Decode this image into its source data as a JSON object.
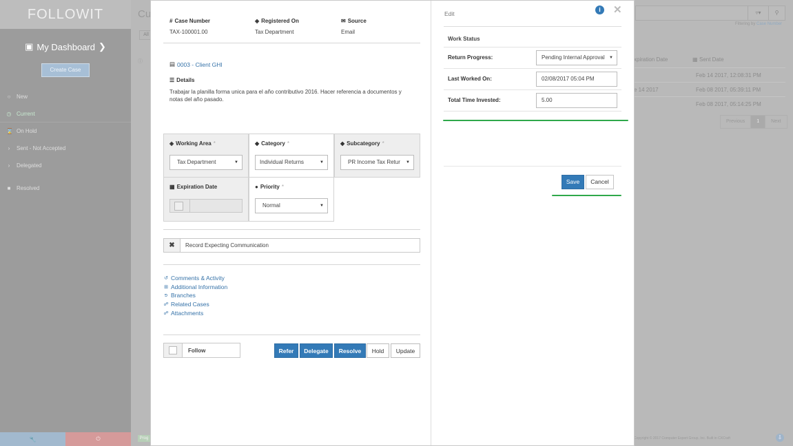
{
  "app": {
    "logo": "FOLLOWIT"
  },
  "sidebar": {
    "dashboard_label": "My Dashboard",
    "create_case_label": "Create Case",
    "items": [
      {
        "label": "New",
        "icon": "circle-icon"
      },
      {
        "label": "Current",
        "icon": "clock-icon"
      },
      {
        "label": "On Hold",
        "icon": "hourglass-icon"
      },
      {
        "label": "Sent - Not Accepted",
        "icon": "chevron-right-icon"
      },
      {
        "label": "Delegated",
        "icon": "chevron-right-icon"
      },
      {
        "label": "Resolved",
        "icon": "square-icon"
      }
    ]
  },
  "background": {
    "title": "Cu",
    "all_label": "All",
    "filtering_prefix": "Filtering by",
    "filtering_link": "Case Number",
    "col_expiration": "xpiration Date",
    "col_sent": "Sent Date",
    "rows": [
      {
        "expiration": "",
        "sent": "Feb 14 2017, 12:08:31 PM"
      },
      {
        "expiration": "e 14 2017",
        "sent": "Feb 08 2017, 05:39:11 PM"
      },
      {
        "expiration": "",
        "sent": "Feb 08 2017, 05:14:25 PM"
      }
    ],
    "pager": {
      "prev": "Previous",
      "page": "1",
      "next": "Next"
    },
    "copyright": "Copyright © 2017 Computer Expert Group, Inc. Built in CXCraft",
    "progress_badge": "Prog"
  },
  "case": {
    "case_number_label": "Case Number",
    "case_number": "TAX-100001.00",
    "registered_label": "Registered On",
    "registered": "Tax Department",
    "source_label": "Source",
    "source": "Email",
    "client": "0003 - Client GHI",
    "details_label": "Details",
    "details": "Trabajar la planilla forma unica para el año contributivo 2016. Hacer referencia a documentos y notas del año pasado.",
    "working_area_label": "Working Area",
    "working_area": "Tax Department",
    "category_label": "Category",
    "category": "Individual Returns",
    "subcategory_label": "Subcategory",
    "subcategory": "PR Income Tax Retur",
    "expiration_label": "Expiration Date",
    "priority_label": "Priority",
    "priority": "Normal",
    "required_mark": "*",
    "record_expecting": "Record Expecting Communication",
    "links": [
      {
        "label": "Comments & Activity",
        "icon": "history-icon"
      },
      {
        "label": "Additional Information",
        "icon": "plus-square-icon"
      },
      {
        "label": "Branches",
        "icon": "branch-icon"
      },
      {
        "label": "Related Cases",
        "icon": "link-icon"
      },
      {
        "label": "Attachments",
        "icon": "paperclip-icon"
      }
    ],
    "follow_label": "Follow",
    "actions": {
      "refer": "Refer",
      "delegate": "Delegate",
      "resolve": "Resolve",
      "hold": "Hold",
      "update": "Update"
    }
  },
  "edit": {
    "title": "Edit",
    "work_status_label": "Work Status",
    "return_progress_label": "Return Progress:",
    "return_progress": "Pending Internal Approval",
    "last_worked_label": "Last Worked On:",
    "last_worked": "02/08/2017 05:04 PM",
    "time_invested_label": "Total Time Invested:",
    "time_invested": "5.00",
    "save_label": "Save",
    "cancel_label": "Cancel"
  },
  "colors": {
    "primary": "#337ab7",
    "accent_green": "#2ea84a",
    "link": "#3572a8"
  }
}
